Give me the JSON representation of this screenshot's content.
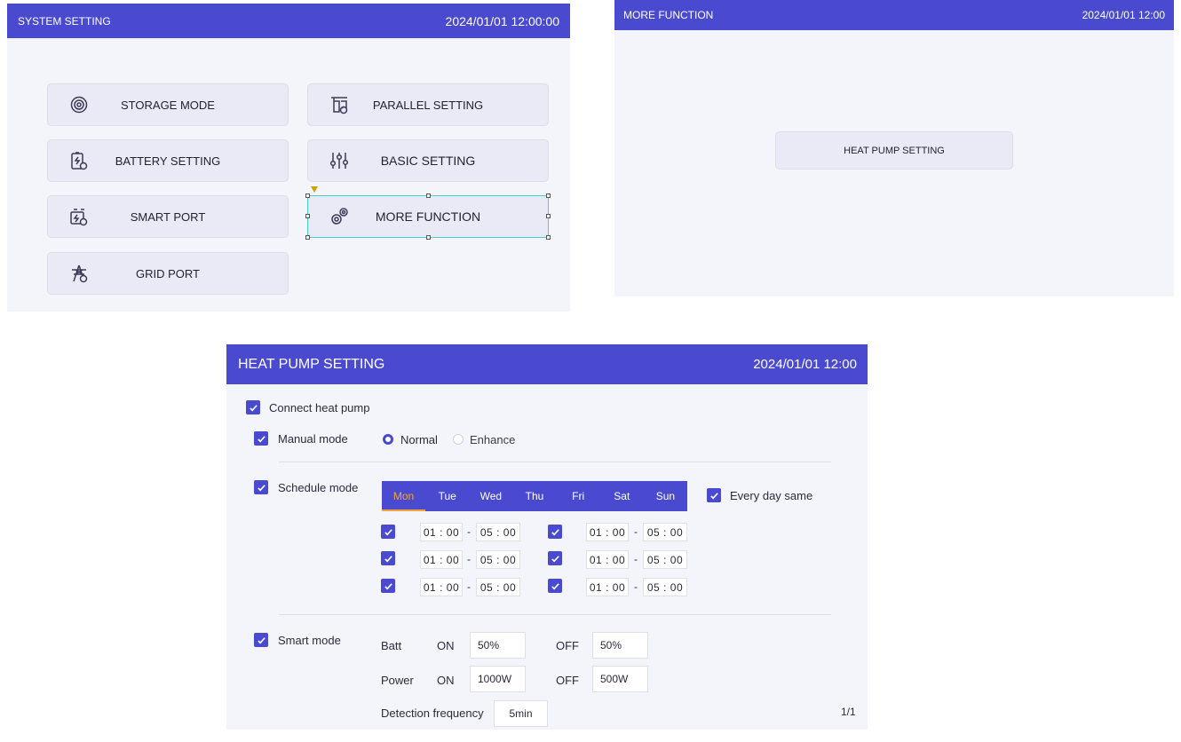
{
  "system": {
    "title": "SYSTEM SETTING",
    "datetime": "2024/01/01 12:00:00",
    "tiles": [
      {
        "label": "STORAGE MODE",
        "icon": "storage-mode-icon"
      },
      {
        "label": "PARALLEL SETTING",
        "icon": "parallel-icon"
      },
      {
        "label": "BATTERY SETTING",
        "icon": "battery-icon"
      },
      {
        "label": "BASIC SETTING",
        "icon": "sliders-icon"
      },
      {
        "label": "SMART PORT",
        "icon": "smart-port-icon"
      },
      {
        "label": "MORE FUNCTION",
        "icon": "gears-icon"
      },
      {
        "label": "GRID PORT",
        "icon": "grid-tower-icon"
      }
    ]
  },
  "more": {
    "title": "MORE FUNCTION",
    "datetime": "2024/01/01 12:00",
    "button": "HEAT PUMP SETTING"
  },
  "heatpump": {
    "title": "HEAT PUMP SETTING",
    "datetime": "2024/01/01 12:00",
    "connect_label": "Connect heat pump",
    "manual_label": "Manual mode",
    "normal_label": "Normal",
    "enhance_label": "Enhance",
    "schedule_label": "Schedule mode",
    "days": [
      "Mon",
      "Tue",
      "Wed",
      "Thu",
      "Fri",
      "Sat",
      "Sun"
    ],
    "active_day": "Mon",
    "every_day_label": "Every day same",
    "slots": [
      {
        "start_h": "01",
        "start_m": "00",
        "end_h": "05",
        "end_m": "00"
      },
      {
        "start_h": "01",
        "start_m": "00",
        "end_h": "05",
        "end_m": "00"
      },
      {
        "start_h": "01",
        "start_m": "00",
        "end_h": "05",
        "end_m": "00"
      },
      {
        "start_h": "01",
        "start_m": "00",
        "end_h": "05",
        "end_m": "00"
      },
      {
        "start_h": "01",
        "start_m": "00",
        "end_h": "05",
        "end_m": "00"
      },
      {
        "start_h": "01",
        "start_m": "00",
        "end_h": "05",
        "end_m": "00"
      }
    ],
    "sep_colon": ":",
    "sep_dash": "-",
    "smart_label": "Smart mode",
    "batt_label": "Batt",
    "power_label": "Power",
    "on_label": "ON",
    "off_label": "OFF",
    "batt_on": "50%",
    "batt_off": "50%",
    "power_on": "1000W",
    "power_off": "500W",
    "detection_label": "Detection frequency",
    "detection_value": "5min",
    "page": "1/1"
  },
  "colors": {
    "accent": "#4a4ad1",
    "active_day": "#f2a23a",
    "selection": "#3fd0d0"
  }
}
